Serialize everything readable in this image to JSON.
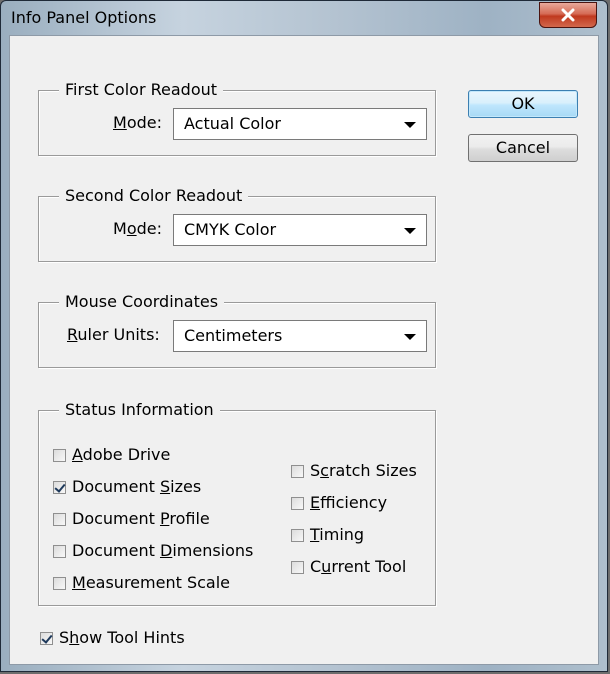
{
  "window": {
    "title": "Info Panel Options",
    "close_glyph": "✕"
  },
  "buttons": {
    "ok_label": "OK",
    "cancel_label": "Cancel"
  },
  "first_readout": {
    "legend": "First Color Readout",
    "mode_label_pre": "",
    "mode_label_key": "M",
    "mode_label_post": "ode:",
    "mode_value": "Actual Color"
  },
  "second_readout": {
    "legend": "Second Color Readout",
    "mode_label_pre": "M",
    "mode_label_key": "o",
    "mode_label_post": "de:",
    "mode_value": "CMYK Color"
  },
  "mouse_coordinates": {
    "legend": "Mouse Coordinates",
    "units_label_pre": "",
    "units_label_key": "R",
    "units_label_post": "uler Units:",
    "units_value": "Centimeters"
  },
  "status_information": {
    "legend": "Status Information",
    "left_items": [
      {
        "pre": "",
        "key": "A",
        "post": "dobe Drive",
        "checked": false
      },
      {
        "pre": "Document ",
        "key": "S",
        "post": "izes",
        "checked": true
      },
      {
        "pre": "Document ",
        "key": "P",
        "post": "rofile",
        "checked": false
      },
      {
        "pre": "Document ",
        "key": "D",
        "post": "imensions",
        "checked": false
      },
      {
        "pre": "",
        "key": "M",
        "post": "easurement Scale",
        "checked": false
      }
    ],
    "right_items": [
      {
        "pre": "S",
        "key": "c",
        "post": "ratch Sizes",
        "checked": false
      },
      {
        "pre": "",
        "key": "E",
        "post": "fficiency",
        "checked": false
      },
      {
        "pre": "",
        "key": "T",
        "post": "iming",
        "checked": false
      },
      {
        "pre": "C",
        "key": "u",
        "post": "rrent Tool",
        "checked": false
      }
    ]
  },
  "show_tool_hints": {
    "pre": "S",
    "key": "h",
    "post": "ow Tool Hints",
    "checked": true
  }
}
